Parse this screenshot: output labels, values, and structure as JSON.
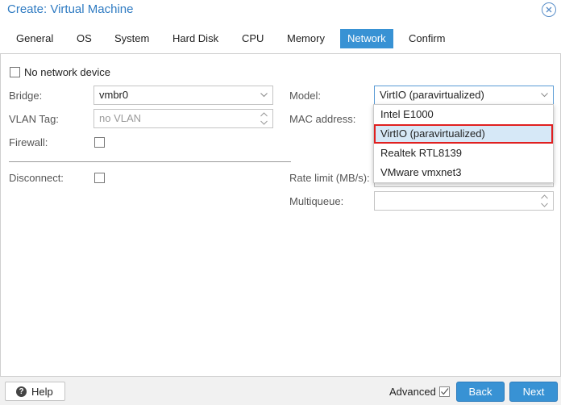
{
  "window": {
    "title": "Create: Virtual Machine"
  },
  "tabs": [
    {
      "label": "General"
    },
    {
      "label": "OS"
    },
    {
      "label": "System"
    },
    {
      "label": "Hard Disk"
    },
    {
      "label": "CPU"
    },
    {
      "label": "Memory"
    },
    {
      "label": "Network",
      "active": true
    },
    {
      "label": "Confirm"
    }
  ],
  "form": {
    "no_network_device": {
      "label": "No network device",
      "checked": false
    },
    "bridge": {
      "label": "Bridge:",
      "value": "vmbr0"
    },
    "vlan_tag": {
      "label": "VLAN Tag:",
      "placeholder": "no VLAN"
    },
    "firewall": {
      "label": "Firewall:",
      "checked": false
    },
    "model": {
      "label": "Model:",
      "value": "VirtIO (paravirtualized)"
    },
    "mac_address": {
      "label": "MAC address:"
    },
    "disconnect": {
      "label": "Disconnect:",
      "checked": false
    },
    "rate_limit": {
      "label": "Rate limit (MB/s):"
    },
    "multiqueue": {
      "label": "Multiqueue:"
    }
  },
  "model_dropdown": {
    "options": [
      {
        "label": "Intel E1000"
      },
      {
        "label": "VirtIO (paravirtualized)",
        "selected": true
      },
      {
        "label": "Realtek RTL8139"
      },
      {
        "label": "VMware vmxnet3"
      }
    ]
  },
  "footer": {
    "help_label": "Help",
    "advanced_label": "Advanced",
    "advanced_checked": true,
    "back_label": "Back",
    "next_label": "Next"
  },
  "colors": {
    "accent": "#3892d4",
    "title": "#2f7bc2",
    "highlight_border": "#e02020"
  }
}
